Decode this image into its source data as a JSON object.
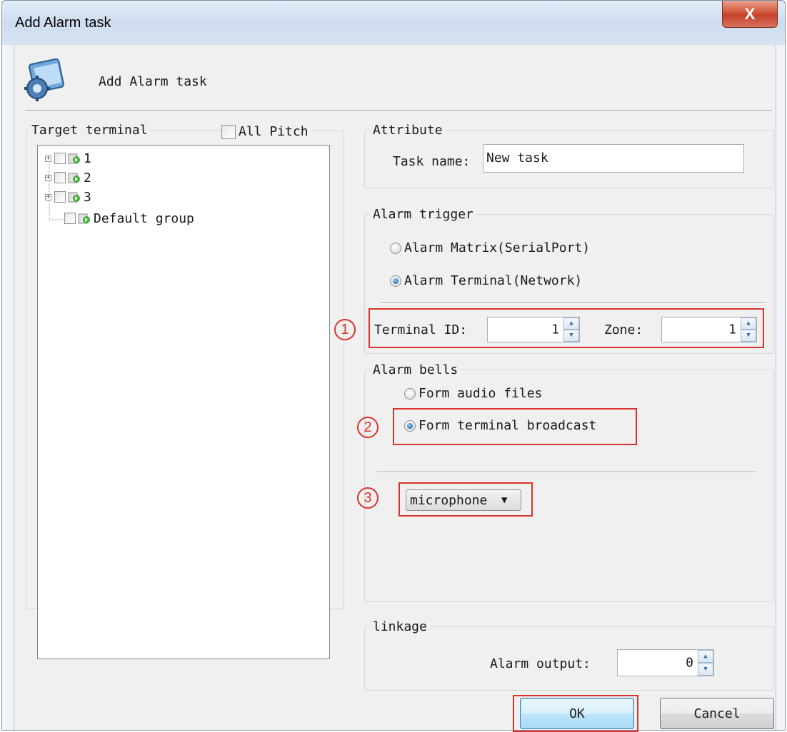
{
  "window": {
    "title": "Add Alarm task",
    "close_glyph": "X"
  },
  "header": {
    "title": "Add Alarm task",
    "icon": "gear-config-icon"
  },
  "target_terminal": {
    "title": "Target terminal",
    "all_pitch_label": "All Pitch",
    "tree": [
      {
        "label": "1",
        "expandable": true
      },
      {
        "label": "2",
        "expandable": true
      },
      {
        "label": "3",
        "expandable": true
      },
      {
        "label": "Default group",
        "expandable": false
      }
    ]
  },
  "attribute": {
    "title": "Attribute",
    "task_name_label": "Task name:",
    "task_name_value": "New task"
  },
  "alarm_trigger": {
    "title": "Alarm trigger",
    "option_matrix": "Alarm Matrix(SerialPort)",
    "option_terminal": "Alarm Terminal(Network)",
    "selected": "option_terminal",
    "terminal_id_label": "Terminal ID:",
    "terminal_id_value": "1",
    "zone_label": "Zone:",
    "zone_value": "1"
  },
  "alarm_bells": {
    "title": "Alarm bells",
    "option_audio": "Form audio files",
    "option_broadcast": "Form terminal broadcast",
    "selected": "option_broadcast",
    "source_value": "microphone"
  },
  "linkage": {
    "title": "linkage",
    "alarm_output_label": "Alarm output:",
    "alarm_output_value": "0"
  },
  "buttons": {
    "ok": "OK",
    "cancel": "Cancel"
  },
  "annotations": {
    "one": "1",
    "two": "2",
    "three": "3"
  },
  "colors": {
    "annotation_red": "#d9342b",
    "close_red": "#c7402a"
  }
}
